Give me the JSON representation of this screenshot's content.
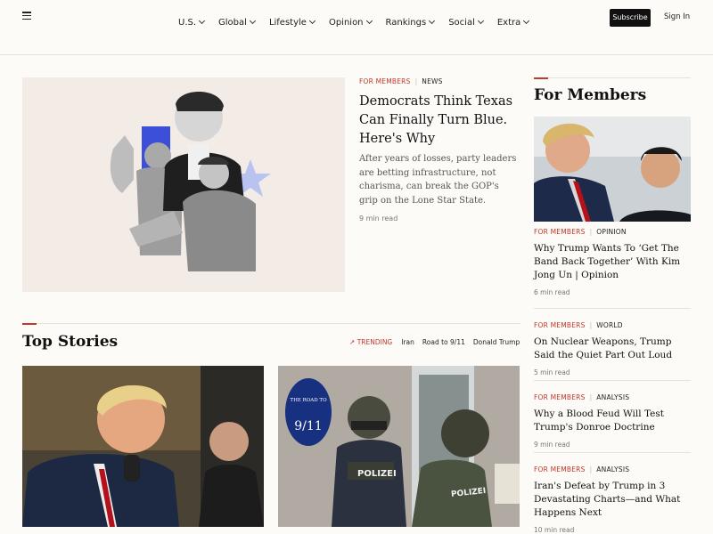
{
  "header": {
    "nav": [
      "U.S.",
      "Global",
      "Lifestyle",
      "Opinion",
      "Rankings",
      "Social",
      "Extra"
    ],
    "subscribe_label": "Subscribe",
    "signin_label": "Sign In"
  },
  "lead": {
    "kicker_members": "FOR MEMBERS",
    "kicker_section": "NEWS",
    "title": "Democrats Think Texas Can Finally Turn Blue. Here's Why",
    "dek": "After years of losses, party leaders are betting infrastructure, not charisma, can break the GOP's grip on the Lone Star State.",
    "read_time": "9 min read"
  },
  "sidebar": {
    "title": "For Members",
    "items": [
      {
        "members": "FOR MEMBERS",
        "section": "OPINION",
        "headline": "Why Trump Wants To ‘Get The Band Back Together’ With Kim Jong Un | Opinion",
        "read": "6 min read"
      },
      {
        "members": "FOR MEMBERS",
        "section": "WORLD",
        "headline": "On Nuclear Weapons, Trump Said the Quiet Part Out Loud",
        "read": "5 min read"
      },
      {
        "members": "FOR MEMBERS",
        "section": "ANALYSIS",
        "headline": "Why a Blood Feud Will Test Trump's Donroe Doctrine",
        "read": "9 min read"
      },
      {
        "members": "FOR MEMBERS",
        "section": "ANALYSIS",
        "headline": "Iran's Defeat by Trump in 3 Devastating Charts—and What Happens Next",
        "read": "10 min read"
      }
    ]
  },
  "top_stories": {
    "title": "Top Stories",
    "trending_label": "TRENDING",
    "trending": [
      "Iran",
      "Road to 9/11",
      "Donald Trump"
    ],
    "badge_small": "THE ROAD TO",
    "badge_big": "9/11",
    "vest_text": "POLIZEI"
  },
  "colors": {
    "accent": "#c0392b",
    "background": "#fcfbf7",
    "lead_bg": "#f3ebe6"
  }
}
